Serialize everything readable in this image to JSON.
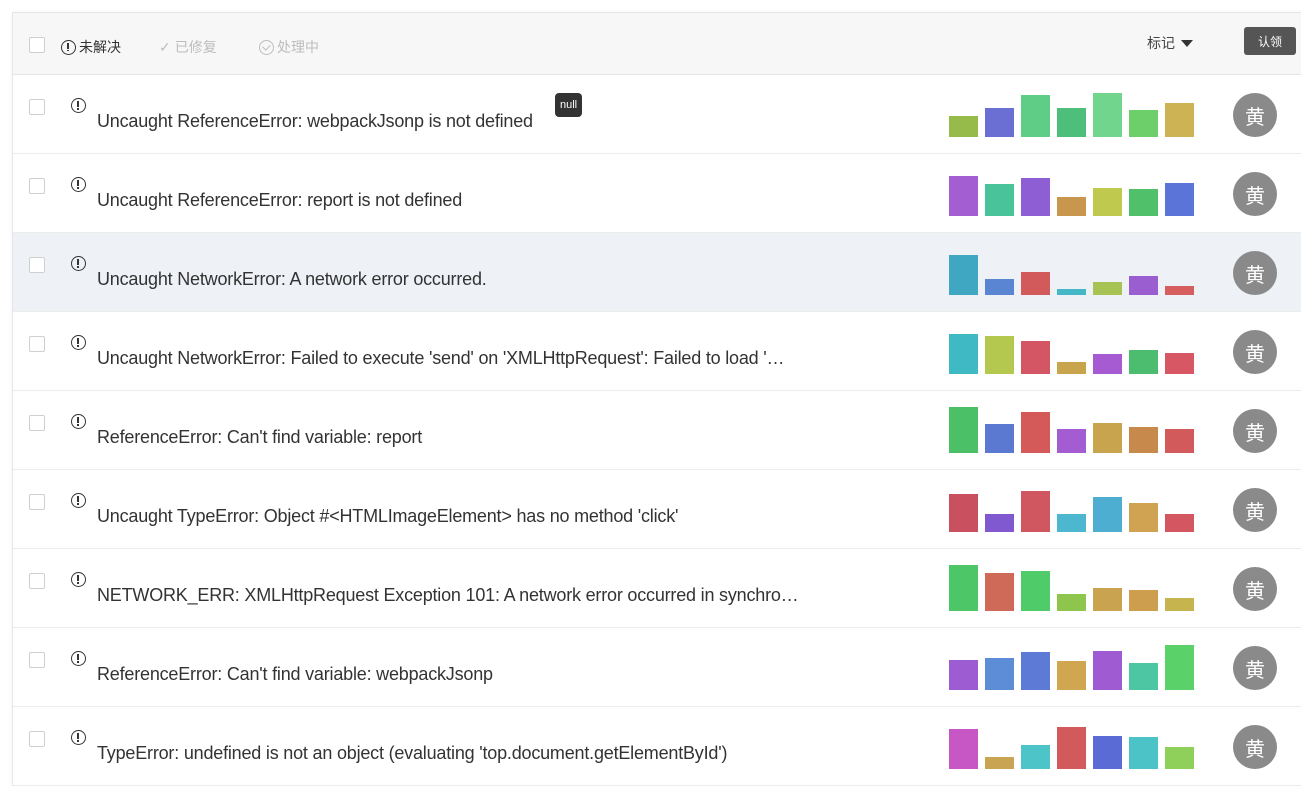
{
  "toolbar": {
    "filters": [
      {
        "label": "未解决",
        "state": "active",
        "icon": "info-circle-icon"
      },
      {
        "label": "已修复",
        "state": "muted",
        "icon": "check-icon"
      },
      {
        "label": "处理中",
        "state": "muted",
        "icon": "progress-circle-icon"
      }
    ],
    "mark_label": "标记",
    "claim_label": "认领"
  },
  "issues": [
    {
      "title": "Uncaught ReferenceError: webpackJsonp is not defined",
      "badge": "null",
      "assignee": "黄",
      "bars": [
        0.45,
        0.62,
        0.92,
        0.64,
        0.95,
        0.58,
        0.74
      ],
      "colors": [
        "#97bb4a",
        "#6b6fd4",
        "#5fcd85",
        "#4dbf7a",
        "#71d58e",
        "#6ccf6a",
        "#cdb354"
      ]
    },
    {
      "title": "Uncaught ReferenceError: report is not defined",
      "assignee": "黄",
      "bars": [
        0.88,
        0.7,
        0.82,
        0.42,
        0.6,
        0.58,
        0.72
      ],
      "colors": [
        "#a35ed1",
        "#49c39a",
        "#8e5fd4",
        "#c9964e",
        "#bec94d",
        "#50c06a",
        "#5b74d8"
      ]
    },
    {
      "title": "Uncaught NetworkError: A network error occurred.",
      "assignee": "黄",
      "bars": [
        0.88,
        0.34,
        0.5,
        0.14,
        0.28,
        0.42,
        0.2
      ],
      "colors": [
        "#3fa7c2",
        "#5a85d3",
        "#d25a5a",
        "#45b8c8",
        "#a6c353",
        "#9b5ed1",
        "#d75e5e"
      ]
    },
    {
      "title": "Uncaught NetworkError: Failed to execute 'send' on 'XMLHttpRequest': Failed to load '…",
      "assignee": "黄",
      "bars": [
        0.88,
        0.82,
        0.72,
        0.26,
        0.44,
        0.52,
        0.46
      ],
      "colors": [
        "#3fbac4",
        "#b4c84f",
        "#d45664",
        "#c8a44c",
        "#a75bd2",
        "#4cbd6f",
        "#d85765"
      ]
    },
    {
      "title": "ReferenceError: Can't find variable: report",
      "assignee": "黄",
      "bars": [
        1.0,
        0.62,
        0.9,
        0.52,
        0.66,
        0.56,
        0.52
      ],
      "colors": [
        "#4cc066",
        "#5b79d1",
        "#d45a5a",
        "#a35cd1",
        "#c9a44e",
        "#c78a4c",
        "#d35a5a"
      ]
    },
    {
      "title": "Uncaught TypeError: Object #<HTMLImageElement> has no method 'click'",
      "assignee": "黄",
      "bars": [
        0.82,
        0.4,
        0.9,
        0.4,
        0.76,
        0.62,
        0.4
      ],
      "colors": [
        "#c9515f",
        "#8059d1",
        "#d0565f",
        "#4db7cf",
        "#4eaed2",
        "#cfa352",
        "#d35660"
      ]
    },
    {
      "title": "NETWORK_ERR: XMLHttpRequest Exception 101: A network error occurred in synchro…",
      "assignee": "黄",
      "bars": [
        1.0,
        0.82,
        0.88,
        0.38,
        0.5,
        0.46,
        0.28
      ],
      "colors": [
        "#4cc666",
        "#d06a58",
        "#4fcb6a",
        "#8ec54d",
        "#c9a350",
        "#cc9e4e",
        "#c6b54e"
      ]
    },
    {
      "title": "ReferenceError: Can't find variable: webpackJsonp",
      "assignee": "黄",
      "bars": [
        0.66,
        0.7,
        0.82,
        0.62,
        0.84,
        0.58,
        0.98
      ],
      "colors": [
        "#9e5cd2",
        "#5d8dd6",
        "#5c7ad6",
        "#d0a650",
        "#9f5cd2",
        "#4cc6a3",
        "#5bd16a"
      ]
    },
    {
      "title": "TypeError: undefined is not an object (evaluating 'top.document.getElementById')",
      "assignee": "黄",
      "bars": [
        0.88,
        0.26,
        0.52,
        0.92,
        0.72,
        0.7,
        0.48
      ],
      "colors": [
        "#c857c6",
        "#c9a553",
        "#4cc4c8",
        "#d35a5a",
        "#5b6bd6",
        "#4bc3c7",
        "#8fd05a"
      ]
    }
  ]
}
